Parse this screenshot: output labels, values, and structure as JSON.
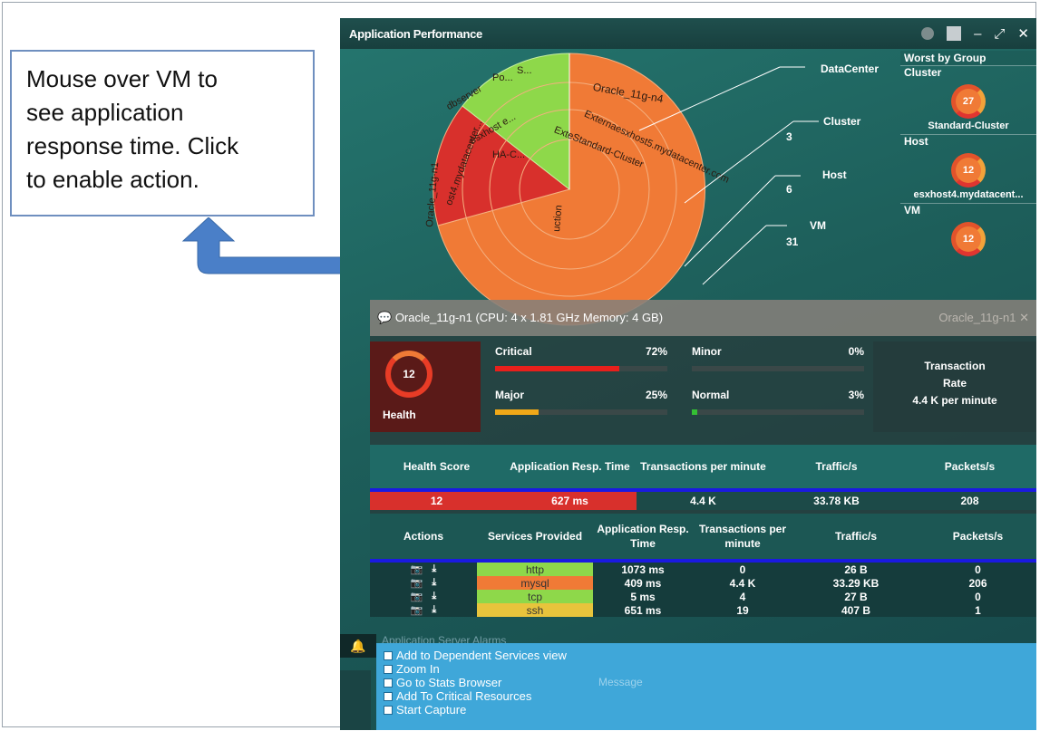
{
  "callout": {
    "lines": [
      "Mouse over VM to",
      "see application",
      "response time. Click",
      "to enable action."
    ]
  },
  "window": {
    "title": "Application Performance"
  },
  "sunburst": {
    "labels": [
      "Oracle_11g-n4",
      "Externaesxhost5.mydatacenter.com",
      "ExteStandard-Cluster",
      "HA-C...",
      "esxhost e...",
      "dbserver",
      "Po...",
      "S...",
      "ost4.mydatacenter...",
      "Oracle_11g-n1",
      "uction"
    ],
    "levels": [
      {
        "name": "DataCenter",
        "count": ""
      },
      {
        "name": "Cluster",
        "count": "3"
      },
      {
        "name": "Host",
        "count": "6"
      },
      {
        "name": "VM",
        "count": "31"
      }
    ]
  },
  "worst": {
    "title": "Worst by Group",
    "groups": [
      {
        "label": "Cluster",
        "score": "27",
        "name": "Standard-Cluster"
      },
      {
        "label": "Host",
        "score": "12",
        "name": "esxhost4.mydatacent..."
      },
      {
        "label": "VM",
        "score": "12",
        "name": ""
      }
    ]
  },
  "vm_panel": {
    "header": "Oracle_11g-n1 (CPU: 4 x 1.81 GHz Memory: 4 GB)",
    "header_right": "Oracle_11g-n1",
    "health": {
      "score": "12",
      "label": "Health"
    },
    "severity": [
      {
        "label": "Critical",
        "pct": "72%",
        "fill": 0.72,
        "color": "#e8201c"
      },
      {
        "label": "Minor",
        "pct": "0%",
        "fill": 0.0,
        "color": "#f0c020"
      },
      {
        "label": "Major",
        "pct": "25%",
        "fill": 0.25,
        "color": "#f0a818"
      },
      {
        "label": "Normal",
        "pct": "3%",
        "fill": 0.03,
        "color": "#34c034"
      }
    ],
    "rate": {
      "label1": "Transaction",
      "label2": "Rate",
      "value": "4.4 K per minute"
    }
  },
  "stats": {
    "headers": [
      "Health Score",
      "Application Resp. Time",
      "Transactions per minute",
      "Traffic/s",
      "Packets/s"
    ],
    "values": [
      "12",
      "627 ms",
      "4.4 K",
      "33.78 KB",
      "208"
    ]
  },
  "services": {
    "headers": [
      "Actions",
      "Services Provided",
      "Application Resp. Time",
      "Transactions per minute",
      "Traffic/s",
      "Packets/s"
    ],
    "rows": [
      {
        "service": "http",
        "color": "#8ed84a",
        "resp": "1073 ms",
        "tpm": "0",
        "traffic": "26 B",
        "packets": "0"
      },
      {
        "service": "mysql",
        "color": "#f07a36",
        "resp": "409 ms",
        "tpm": "4.4 K",
        "traffic": "33.29 KB",
        "packets": "206"
      },
      {
        "service": "tcp",
        "color": "#8ed84a",
        "resp": "5 ms",
        "tpm": "4",
        "traffic": "27 B",
        "packets": "0"
      },
      {
        "service": "ssh",
        "color": "#e8c43c",
        "resp": "651 ms",
        "tpm": "19",
        "traffic": "407 B",
        "packets": "1"
      }
    ],
    "action_icons": [
      "camera-icon",
      "download-icon"
    ]
  },
  "alarms": {
    "title": "Application Server Alarms",
    "message_hint": "Message"
  },
  "context_menu": {
    "items": [
      "Add to Dependent Services view",
      "Zoom In",
      "Go to Stats Browser",
      "Add To Critical Resources",
      "Start Capture"
    ]
  },
  "colors": {
    "accent_red": "#d8302c",
    "accent_orange": "#f07a36",
    "accent_green": "#8ed84a",
    "selection_blue": "#1a1ae0",
    "menu_blue": "#3fa7d9"
  }
}
